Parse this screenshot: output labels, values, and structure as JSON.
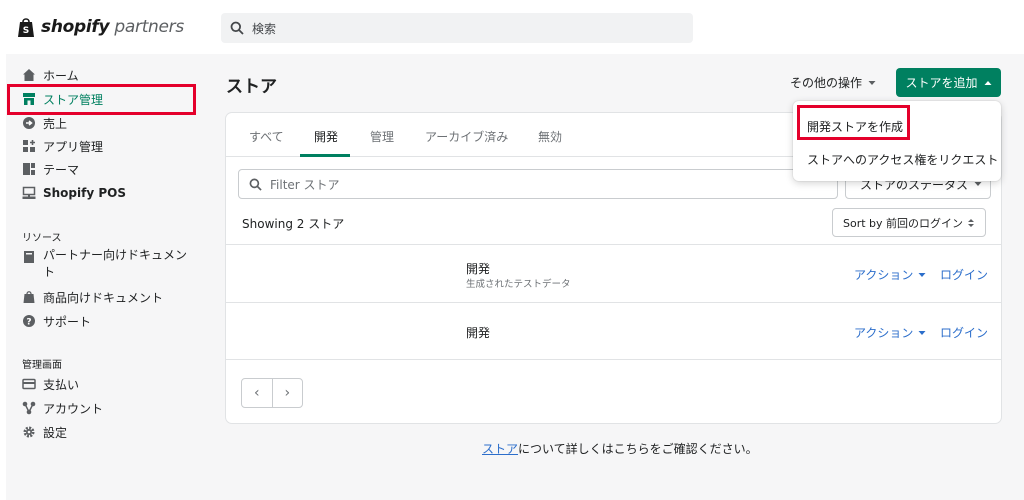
{
  "brand": {
    "logo_bold": "shopify",
    "logo_light": "partners"
  },
  "search": {
    "placeholder": "検索"
  },
  "sidebar": {
    "items": [
      {
        "label": "ホーム",
        "icon": "home-icon"
      },
      {
        "label": "ストア管理",
        "icon": "store-icon",
        "active": true
      },
      {
        "label": "売上",
        "icon": "payments-arrow-icon"
      },
      {
        "label": "アプリ管理",
        "icon": "apps-icon"
      },
      {
        "label": "テーマ",
        "icon": "theme-icon"
      },
      {
        "label": "Shopify POS",
        "icon": "pos-icon"
      }
    ],
    "resources_heading": "リソース",
    "resources": [
      {
        "label": "パートナー向けドキュメン",
        "label_cont": "ト",
        "icon": "book-icon"
      },
      {
        "label": "商品向けドキュメント",
        "icon": "shopify-bag-icon"
      },
      {
        "label": "サポート",
        "icon": "help-icon"
      }
    ],
    "admin_heading": "管理画面",
    "admin": [
      {
        "label": "支払い",
        "icon": "card-icon"
      },
      {
        "label": "アカウント",
        "icon": "account-icon"
      },
      {
        "label": "設定",
        "icon": "gear-icon"
      }
    ]
  },
  "page": {
    "title": "ストア",
    "more_actions": "その他の操作",
    "add_store": "ストアを追加"
  },
  "tabs": [
    "すべて",
    "開発",
    "管理",
    "アーカイブ済み",
    "無効"
  ],
  "active_tab": 1,
  "filter": {
    "placeholder": "Filter ストア",
    "status_label": "ストアのステータス"
  },
  "showing": "Showing 2 ストア",
  "sort": {
    "label": "Sort by 前回のログイン"
  },
  "rows": [
    {
      "name": "開発",
      "sub": "生成されたテストデータ",
      "action": "アクション",
      "login": "ログイン"
    },
    {
      "name": "開発",
      "sub": "",
      "action": "アクション",
      "login": "ログイン"
    }
  ],
  "pager": {
    "prev": "‹",
    "next": "›"
  },
  "footer": {
    "link": "ストア",
    "text": "について詳しくはこちらをご確認ください。"
  },
  "dropdown": {
    "items": [
      "開発ストアを作成",
      "ストアへのアクセス権をリクエスト"
    ]
  },
  "colors": {
    "accent": "#008060",
    "link": "#2c6ecb",
    "highlight": "#e4002b"
  }
}
